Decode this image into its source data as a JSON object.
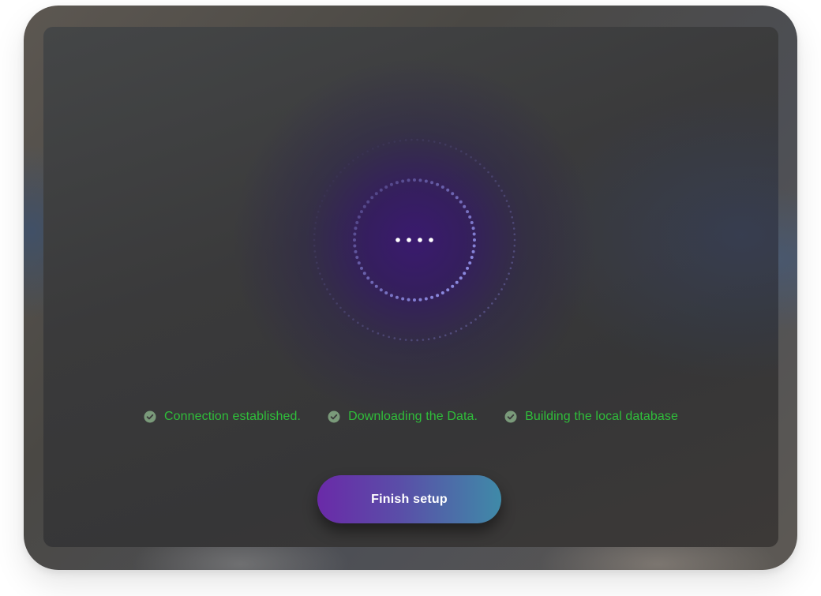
{
  "loader": {
    "icon": "dotted-rings-loader-icon",
    "ring_color": "#8f8ee6",
    "center_dot_color": "#ffffff"
  },
  "steps": [
    {
      "label": "Connection established.",
      "icon": "check-circle-icon"
    },
    {
      "label": "Downloading the Data.",
      "icon": "check-circle-icon"
    },
    {
      "label": "Building the local database",
      "icon": "check-circle-icon"
    }
  ],
  "actions": {
    "finish_label": "Finish setup"
  },
  "colors": {
    "success": "#2fbe3a",
    "accent_start": "#6a2aa8",
    "accent_end": "#3f8aa8"
  }
}
